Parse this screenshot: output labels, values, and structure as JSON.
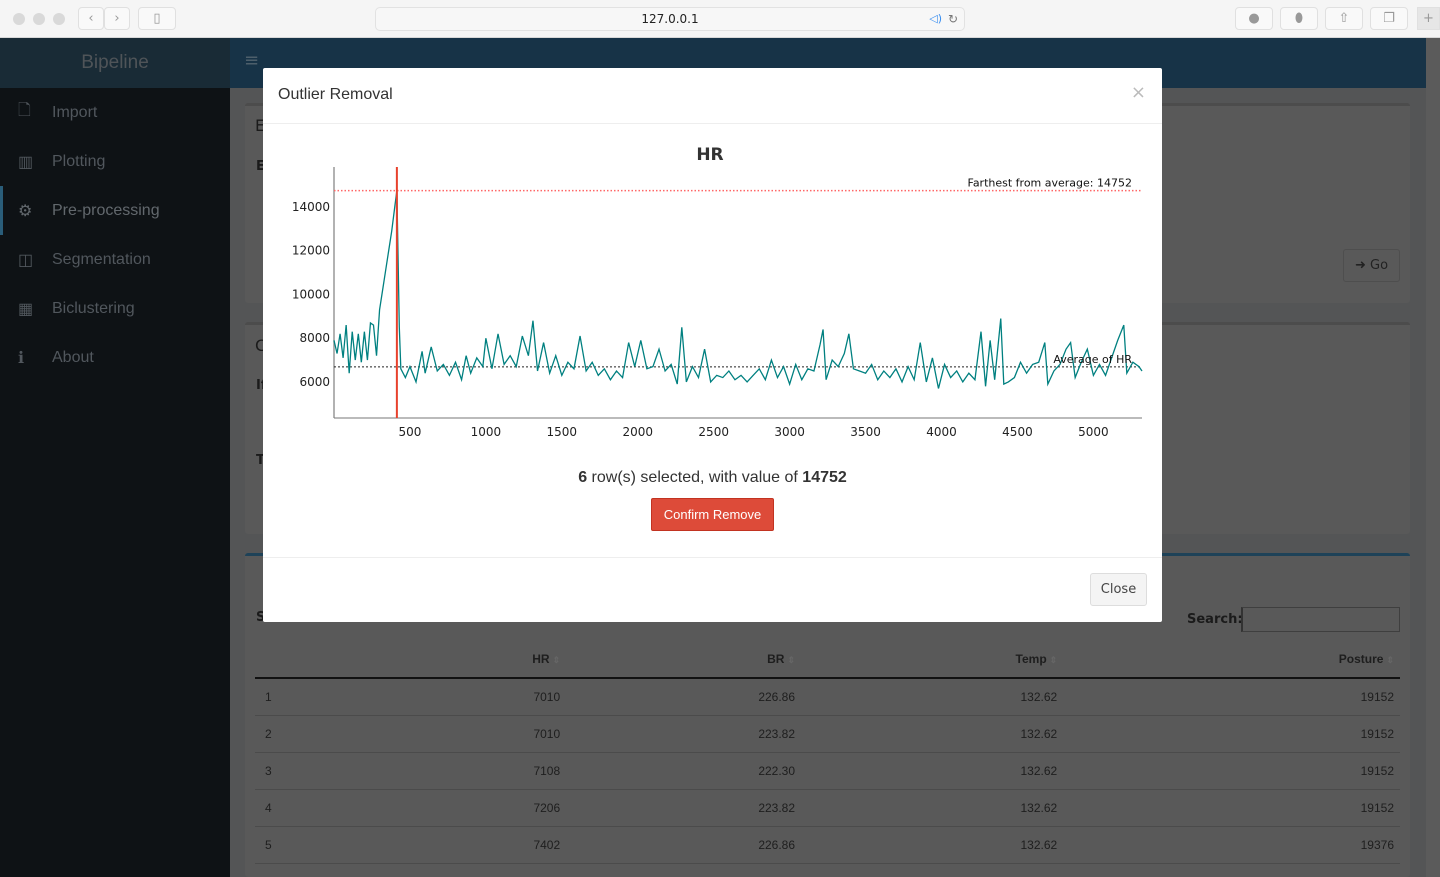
{
  "browser": {
    "url": "127.0.0.1",
    "icons": [
      "back-icon",
      "forward-icon",
      "sidebar-icon",
      "audio-icon",
      "reload-icon",
      "download-icon",
      "extension-icon",
      "share-icon",
      "tabs-icon",
      "new-tab-icon"
    ]
  },
  "app": {
    "brand": "Bipeline",
    "menu_icon": "hamburger-icon"
  },
  "sidebar": {
    "items": [
      {
        "label": "Import",
        "icon": "file-icon"
      },
      {
        "label": "Plotting",
        "icon": "bar-chart-icon"
      },
      {
        "label": "Pre-processing",
        "icon": "gears-icon",
        "active": true
      },
      {
        "label": "Segmentation",
        "icon": "columns-icon"
      },
      {
        "label": "Biclustering",
        "icon": "grid-icon"
      },
      {
        "label": "About",
        "icon": "info-icon"
      }
    ]
  },
  "background": {
    "fragments": [
      "E",
      "E",
      "C",
      "If",
      "T",
      "S"
    ],
    "go_label": "Go",
    "search_label": "Search:",
    "search_value": ""
  },
  "table": {
    "columns": [
      "",
      "HR",
      "BR",
      "Temp",
      "Posture"
    ],
    "rows": [
      [
        "1",
        "7010",
        "226.86",
        "132.62",
        "19152"
      ],
      [
        "2",
        "7010",
        "223.82",
        "132.62",
        "19152"
      ],
      [
        "3",
        "7108",
        "222.30",
        "132.62",
        "19152"
      ],
      [
        "4",
        "7206",
        "223.82",
        "132.62",
        "19152"
      ],
      [
        "5",
        "7402",
        "226.86",
        "132.62",
        "19376"
      ]
    ]
  },
  "modal": {
    "title": "Outlier Removal",
    "close_x": "×",
    "count": "6",
    "selected_text": " row(s) selected, with value of ",
    "value": "14752",
    "confirm_label": "Confirm Remove",
    "close_label": "Close"
  },
  "chart_data": {
    "type": "line",
    "title": "HR",
    "xlabel": "",
    "ylabel": "",
    "xlim": [
      0,
      5320
    ],
    "ylim": [
      4350,
      15830
    ],
    "xticks": [
      500,
      1000,
      1500,
      2000,
      2500,
      3000,
      3500,
      4000,
      4500,
      5000
    ],
    "yticks": [
      6000,
      8000,
      10000,
      12000,
      14000
    ],
    "line_color": "#008080",
    "outlier": {
      "x": 414,
      "value": 14752,
      "label": "Farthest from average: 14752",
      "color": "#e8412c"
    },
    "average": {
      "value": 6690,
      "label": "Average of HR"
    },
    "points": [
      [
        0,
        7900
      ],
      [
        20,
        7300
      ],
      [
        40,
        8200
      ],
      [
        60,
        7100
      ],
      [
        80,
        8600
      ],
      [
        100,
        6400
      ],
      [
        120,
        8300
      ],
      [
        140,
        7000
      ],
      [
        160,
        8200
      ],
      [
        180,
        6900
      ],
      [
        200,
        8300
      ],
      [
        220,
        7000
      ],
      [
        240,
        8700
      ],
      [
        260,
        8600
      ],
      [
        280,
        7200
      ],
      [
        300,
        9300
      ],
      [
        320,
        10200
      ],
      [
        340,
        11100
      ],
      [
        360,
        12000
      ],
      [
        380,
        12900
      ],
      [
        400,
        14000
      ],
      [
        414,
        14752
      ],
      [
        430,
        8500
      ],
      [
        440,
        6600
      ],
      [
        470,
        6200
      ],
      [
        500,
        6700
      ],
      [
        540,
        6000
      ],
      [
        580,
        7400
      ],
      [
        600,
        6400
      ],
      [
        640,
        7600
      ],
      [
        680,
        6500
      ],
      [
        720,
        6800
      ],
      [
        760,
        6300
      ],
      [
        800,
        6900
      ],
      [
        840,
        6100
      ],
      [
        870,
        7200
      ],
      [
        900,
        6400
      ],
      [
        940,
        7100
      ],
      [
        980,
        6700
      ],
      [
        1000,
        8000
      ],
      [
        1040,
        6600
      ],
      [
        1080,
        8200
      ],
      [
        1120,
        6800
      ],
      [
        1160,
        7200
      ],
      [
        1200,
        6700
      ],
      [
        1240,
        8100
      ],
      [
        1280,
        7200
      ],
      [
        1310,
        8800
      ],
      [
        1340,
        6500
      ],
      [
        1380,
        7800
      ],
      [
        1420,
        6400
      ],
      [
        1460,
        7200
      ],
      [
        1500,
        6300
      ],
      [
        1540,
        6900
      ],
      [
        1580,
        6600
      ],
      [
        1620,
        8100
      ],
      [
        1660,
        6500
      ],
      [
        1700,
        6900
      ],
      [
        1740,
        6300
      ],
      [
        1780,
        6600
      ],
      [
        1820,
        6100
      ],
      [
        1860,
        6500
      ],
      [
        1900,
        6200
      ],
      [
        1940,
        7800
      ],
      [
        1980,
        6700
      ],
      [
        2020,
        7900
      ],
      [
        2060,
        6600
      ],
      [
        2100,
        6700
      ],
      [
        2140,
        7500
      ],
      [
        2180,
        6500
      ],
      [
        2220,
        6800
      ],
      [
        2260,
        5900
      ],
      [
        2290,
        8500
      ],
      [
        2320,
        6000
      ],
      [
        2360,
        6700
      ],
      [
        2400,
        6200
      ],
      [
        2440,
        7500
      ],
      [
        2480,
        6000
      ],
      [
        2520,
        6300
      ],
      [
        2560,
        6200
      ],
      [
        2600,
        6500
      ],
      [
        2640,
        6100
      ],
      [
        2680,
        6300
      ],
      [
        2720,
        6000
      ],
      [
        2760,
        6300
      ],
      [
        2800,
        6600
      ],
      [
        2840,
        6100
      ],
      [
        2880,
        7000
      ],
      [
        2920,
        6200
      ],
      [
        2960,
        6700
      ],
      [
        3000,
        5900
      ],
      [
        3040,
        6800
      ],
      [
        3080,
        6100
      ],
      [
        3120,
        6600
      ],
      [
        3160,
        6500
      ],
      [
        3200,
        7700
      ],
      [
        3220,
        8400
      ],
      [
        3240,
        6100
      ],
      [
        3280,
        7000
      ],
      [
        3320,
        6700
      ],
      [
        3360,
        7300
      ],
      [
        3390,
        8200
      ],
      [
        3420,
        6600
      ],
      [
        3460,
        6500
      ],
      [
        3500,
        6400
      ],
      [
        3540,
        6800
      ],
      [
        3580,
        6100
      ],
      [
        3620,
        6500
      ],
      [
        3660,
        6200
      ],
      [
        3700,
        6600
      ],
      [
        3740,
        6000
      ],
      [
        3780,
        6700
      ],
      [
        3820,
        6100
      ],
      [
        3860,
        7800
      ],
      [
        3900,
        6000
      ],
      [
        3940,
        7100
      ],
      [
        3980,
        5700
      ],
      [
        4020,
        6800
      ],
      [
        4060,
        6200
      ],
      [
        4100,
        6500
      ],
      [
        4140,
        6000
      ],
      [
        4180,
        6400
      ],
      [
        4220,
        6100
      ],
      [
        4260,
        8300
      ],
      [
        4290,
        5800
      ],
      [
        4320,
        7900
      ],
      [
        4350,
        6100
      ],
      [
        4390,
        8900
      ],
      [
        4410,
        5900
      ],
      [
        4440,
        6000
      ],
      [
        4480,
        6200
      ],
      [
        4520,
        6900
      ],
      [
        4560,
        6400
      ],
      [
        4600,
        6800
      ],
      [
        4640,
        6900
      ],
      [
        4680,
        7800
      ],
      [
        4700,
        5900
      ],
      [
        4740,
        6500
      ],
      [
        4780,
        6800
      ],
      [
        4820,
        7500
      ],
      [
        4850,
        7800
      ],
      [
        4880,
        6200
      ],
      [
        4920,
        6900
      ],
      [
        4960,
        7500
      ],
      [
        5000,
        6300
      ],
      [
        5040,
        6800
      ],
      [
        5080,
        6300
      ],
      [
        5120,
        7100
      ],
      [
        5160,
        7900
      ],
      [
        5200,
        8600
      ],
      [
        5220,
        6400
      ],
      [
        5260,
        6900
      ],
      [
        5300,
        6700
      ],
      [
        5320,
        6500
      ]
    ]
  }
}
